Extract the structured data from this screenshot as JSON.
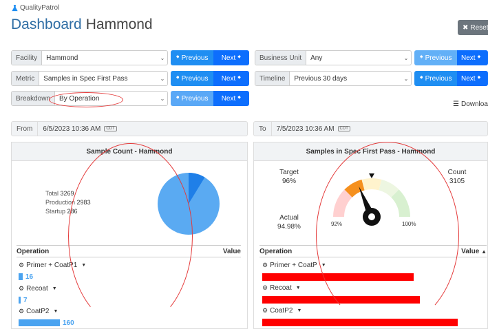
{
  "app": {
    "brand": "QualityPatrol"
  },
  "page": {
    "title": "Dashboard",
    "subtitle": "Hammond"
  },
  "toolbar": {
    "reset_label": "Reset",
    "download_label": "Downloa"
  },
  "filters": {
    "facility": {
      "label": "Facility",
      "value": "Hammond"
    },
    "metric": {
      "label": "Metric",
      "value": "Samples in Spec First Pass"
    },
    "breakdown": {
      "label": "Breakdown",
      "value": "By Operation"
    },
    "business_unit": {
      "label": "Business Unit",
      "value": "Any"
    },
    "timeline": {
      "label": "Timeline",
      "value": "Previous 30 days"
    }
  },
  "nav": {
    "previous_label": "Previous",
    "next_label": "Next"
  },
  "range": {
    "from_label": "From",
    "from_value": "6/5/2023 10:36 AM",
    "to_label": "To",
    "to_value": "7/5/2023 10:36 AM",
    "tz": "CDT"
  },
  "sample_panel": {
    "title": "Sample Count - Hammond",
    "total_label": "Total",
    "total_value": "3269",
    "production_label": "Production",
    "production_value": "2983",
    "startup_label": "Startup",
    "startup_value": "286",
    "col_operation": "Operation",
    "col_value": "Value",
    "rows": [
      {
        "name": "Primer + CoatP1",
        "value": "16",
        "count": 16
      },
      {
        "name": "Recoat",
        "value": "7",
        "count": 7
      },
      {
        "name": "CoatP2",
        "value": "160",
        "count": 160
      }
    ]
  },
  "spec_panel": {
    "title": "Samples in Spec First Pass - Hammond",
    "target_label": "Target",
    "target_value": "96%",
    "count_label": "Count",
    "count_value": "3105",
    "actual_label": "Actual",
    "actual_value": "94.98%",
    "gauge_min": "92%",
    "gauge_max": "100%",
    "col_operation": "Operation",
    "col_value": "Value",
    "rows": [
      {
        "name": "Primer + CoatP",
        "value": "68.75%",
        "percent": 68.75
      },
      {
        "name": "Recoat",
        "value": "71.43%",
        "percent": 71.43
      },
      {
        "name": "CoatP2",
        "value": "88.75%",
        "percent": 88.75
      }
    ]
  },
  "colors": {
    "accent": "#0d6efd",
    "title_blue": "#2e6da4",
    "bar_blue": "#4aa3f0",
    "bar_red": "#ff0000",
    "annotation": "#e43a3a"
  }
}
